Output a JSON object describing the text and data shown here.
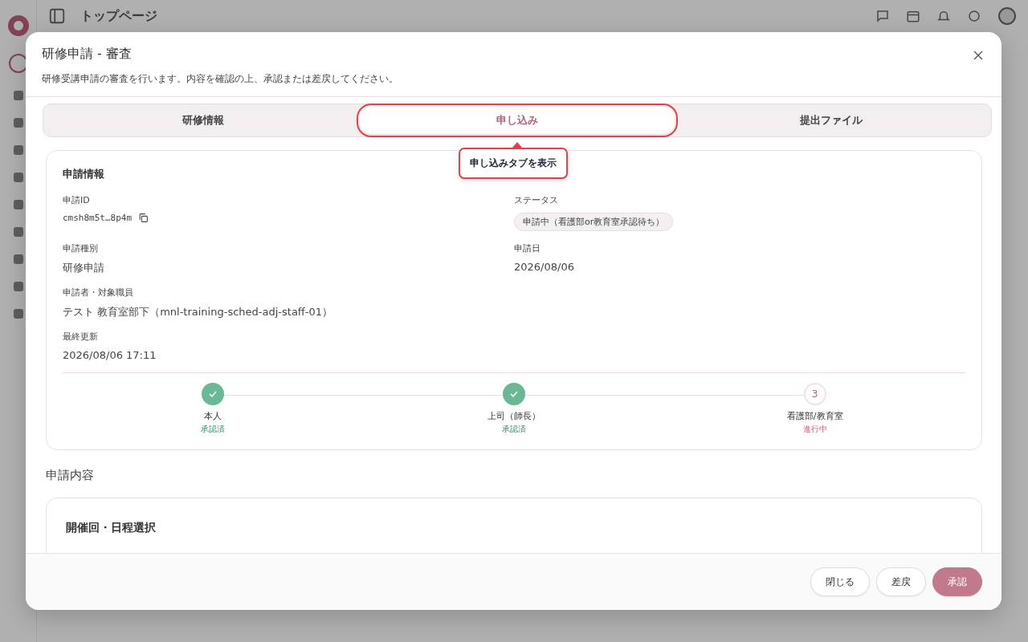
{
  "background": {
    "page_title": "トップページ"
  },
  "dialog": {
    "title": "研修申請 - 審査",
    "description": "研修受講申請の審査を行います。内容を確認の上、承認または差戻してください。",
    "tabs": [
      {
        "label": "研修情報",
        "selected": false,
        "highlighted": false
      },
      {
        "label": "申し込み",
        "selected": true,
        "highlighted": true
      },
      {
        "label": "提出ファイル",
        "selected": false,
        "highlighted": false
      }
    ],
    "tooltip": "申し込みタブを表示",
    "info_card": {
      "title": "申請情報",
      "rows": [
        [
          {
            "label": "申請ID",
            "value": "cmsh8m5t…8p4m",
            "kind": "id"
          },
          {
            "label": "ステータス",
            "value": "申請中（看護部or教育室承認待ち）",
            "kind": "badge"
          }
        ],
        [
          {
            "label": "申請種別",
            "value": "研修申請",
            "kind": "text"
          },
          {
            "label": "申請日",
            "value": "2026/08/06",
            "kind": "text"
          }
        ],
        [
          {
            "label": "申請者・対象職員",
            "value": "テスト 教育室部下（mnl-training-sched-adj-staff-01）",
            "kind": "text"
          }
        ],
        [
          {
            "label": "最終更新",
            "value": "2026/08/06 17:11",
            "kind": "text"
          }
        ]
      ],
      "steps": [
        {
          "label": "本人",
          "status": "承認済",
          "done": true
        },
        {
          "label": "上司（師長）",
          "status": "承認済",
          "done": true
        },
        {
          "number": "3",
          "label": "看護部/教育室",
          "status": "進行中",
          "done": false
        }
      ]
    },
    "section_title": "申請内容",
    "content_card": {
      "title": "開催回・日程選択"
    },
    "buttons": [
      {
        "label": "閉じる",
        "kind": "secondary"
      },
      {
        "label": "差戻",
        "kind": "secondary"
      },
      {
        "label": "承認",
        "kind": "primary"
      }
    ]
  }
}
